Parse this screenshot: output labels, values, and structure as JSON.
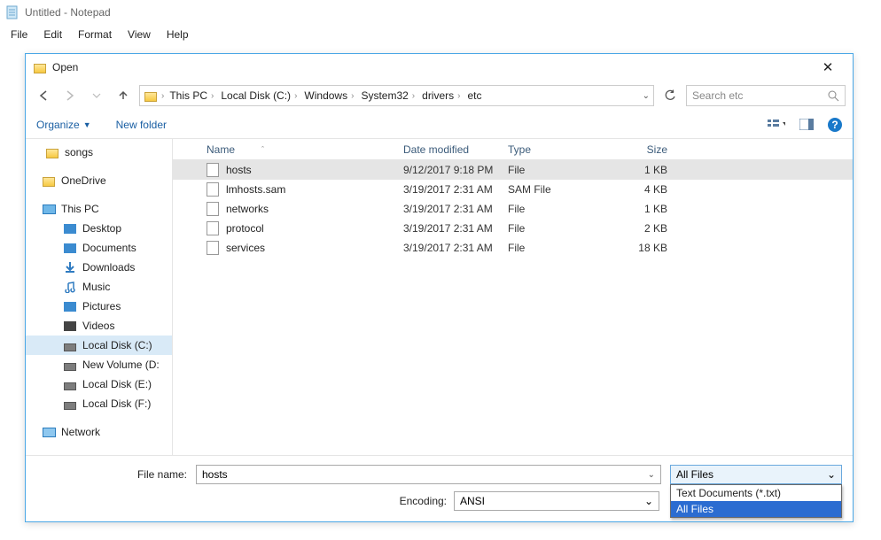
{
  "notepad": {
    "title": "Untitled - Notepad",
    "menu": {
      "file": "File",
      "edit": "Edit",
      "format": "Format",
      "view": "View",
      "help": "Help"
    }
  },
  "dialog": {
    "title": "Open",
    "nav": {
      "back": "←",
      "fwd": "→",
      "up": "↑"
    },
    "breadcrumbs": [
      "This PC",
      "Local Disk (C:)",
      "Windows",
      "System32",
      "drivers",
      "etc"
    ],
    "search_placeholder": "Search etc",
    "toolbar": {
      "organize": "Organize",
      "newfolder": "New folder",
      "help": "?"
    },
    "tree": {
      "songs": "songs",
      "onedrive": "OneDrive",
      "thispc": "This PC",
      "desktop": "Desktop",
      "documents": "Documents",
      "downloads": "Downloads",
      "music": "Music",
      "pictures": "Pictures",
      "videos": "Videos",
      "localc": "Local Disk (C:)",
      "newvol": "New Volume (D:",
      "locale": "Local Disk (E:)",
      "localf": "Local Disk (F:)",
      "network": "Network"
    },
    "columns": {
      "name": "Name",
      "date": "Date modified",
      "type": "Type",
      "size": "Size"
    },
    "files": [
      {
        "name": "hosts",
        "date": "9/12/2017 9:18 PM",
        "type": "File",
        "size": "1 KB",
        "selected": true
      },
      {
        "name": "lmhosts.sam",
        "date": "3/19/2017 2:31 AM",
        "type": "SAM File",
        "size": "4 KB",
        "selected": false
      },
      {
        "name": "networks",
        "date": "3/19/2017 2:31 AM",
        "type": "File",
        "size": "1 KB",
        "selected": false
      },
      {
        "name": "protocol",
        "date": "3/19/2017 2:31 AM",
        "type": "File",
        "size": "2 KB",
        "selected": false
      },
      {
        "name": "services",
        "date": "3/19/2017 2:31 AM",
        "type": "File",
        "size": "18 KB",
        "selected": false
      }
    ],
    "filename_label": "File name:",
    "filename_value": "hosts",
    "encoding_label": "Encoding:",
    "encoding_value": "ANSI",
    "filter_selected": "All Files",
    "filter_options": [
      "Text Documents (*.txt)",
      "All Files"
    ]
  }
}
